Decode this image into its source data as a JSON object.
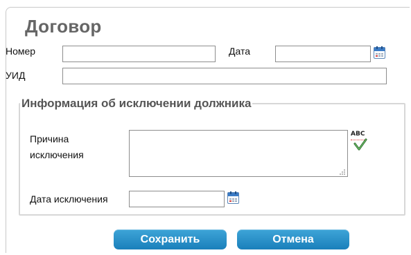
{
  "title": "Договор",
  "fields": {
    "number_label": "Номер",
    "number_value": "",
    "date_label": "Дата",
    "date_value": "",
    "uid_label": "УИД",
    "uid_value": ""
  },
  "exclusion": {
    "legend": "Информация об исключении должника",
    "reason_label_line1": "Причина",
    "reason_label_line2": "исключения",
    "reason_value": "",
    "date_label": "Дата исключения",
    "date_value": ""
  },
  "buttons": {
    "save": "Сохранить",
    "cancel": "Отмена"
  },
  "icons": {
    "calendar": "calendar-icon",
    "spellcheck": "spellcheck-icon",
    "resize": "resize-grip-icon"
  },
  "colors": {
    "button": "#1f8cc8",
    "title": "#666666",
    "border": "#d7d7d7"
  }
}
